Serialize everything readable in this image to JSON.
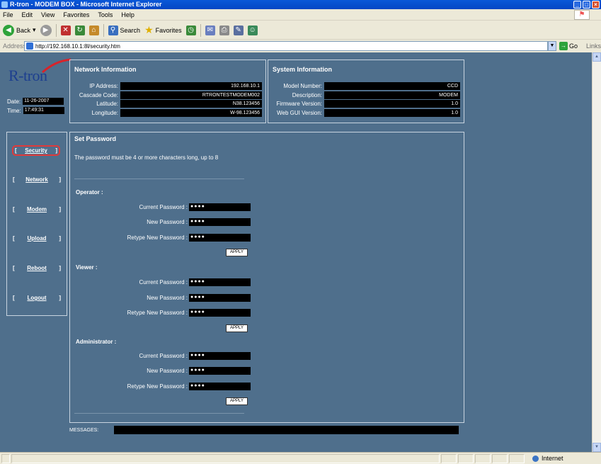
{
  "window": {
    "title": "R-tron - MODEM BOX - Microsoft Internet Explorer"
  },
  "menu": [
    "File",
    "Edit",
    "View",
    "Favorites",
    "Tools",
    "Help"
  ],
  "toolbar": {
    "back": "Back",
    "search": "Search",
    "favorites": "Favorites"
  },
  "address": {
    "label": "Address",
    "url": "http://192.168.10.1:8l/security.htm",
    "go": "Go",
    "links": "Links"
  },
  "status": {
    "zone": "Internet"
  },
  "logo": "R-tron",
  "datetime": {
    "date_label": "Date:",
    "date": "11-26-2007",
    "time_label": "Time:",
    "time": "17:49:31"
  },
  "network": {
    "title": "Network Information",
    "rows": [
      {
        "label": "IP Address:",
        "value": "192.168.10.1"
      },
      {
        "label": "Cascade Code:",
        "value": "RTRONTESTMODEM002"
      },
      {
        "label": "Latitude:",
        "value": "N38.123456"
      },
      {
        "label": "Longitude:",
        "value": "W-98.123456"
      }
    ]
  },
  "system": {
    "title": "System Information",
    "rows": [
      {
        "label": "Model Number:",
        "value": "CCD"
      },
      {
        "label": "Description:",
        "value": "MODEM"
      },
      {
        "label": "Firmware Version:",
        "value": "1.0"
      },
      {
        "label": "Web GUI Version:",
        "value": "1.0"
      }
    ]
  },
  "nav": [
    {
      "label": "Security",
      "active": true
    },
    {
      "label": "Network"
    },
    {
      "label": "Modem"
    },
    {
      "label": "Upload"
    },
    {
      "label": "Reboot"
    },
    {
      "label": "Logout"
    }
  ],
  "set_password": {
    "title": "Set Password",
    "description": "The password must be 4 or more characters long, up to 8",
    "groups": [
      {
        "name": "Operator :",
        "fields": [
          {
            "label": "Current Password :",
            "value": "●●●●"
          },
          {
            "label": "New Password :",
            "value": "●●●●"
          },
          {
            "label": "Retype New Password :",
            "value": "●●●●"
          }
        ],
        "apply": "APPLY"
      },
      {
        "name": "Viewer :",
        "fields": [
          {
            "label": "Current Password :",
            "value": "●●●●"
          },
          {
            "label": "New Password :",
            "value": "●●●●"
          },
          {
            "label": "Retype New Password :",
            "value": "●●●●"
          }
        ],
        "apply": "APPLY"
      },
      {
        "name": "Administrator :",
        "fields": [
          {
            "label": "Current Password :",
            "value": "●●●●"
          },
          {
            "label": "New Password :",
            "value": "●●●●"
          },
          {
            "label": "Retype New Password :",
            "value": "●●●●"
          }
        ],
        "apply": "APPLY"
      }
    ]
  },
  "messages": {
    "label": "MESSAGES:",
    "value": ""
  }
}
